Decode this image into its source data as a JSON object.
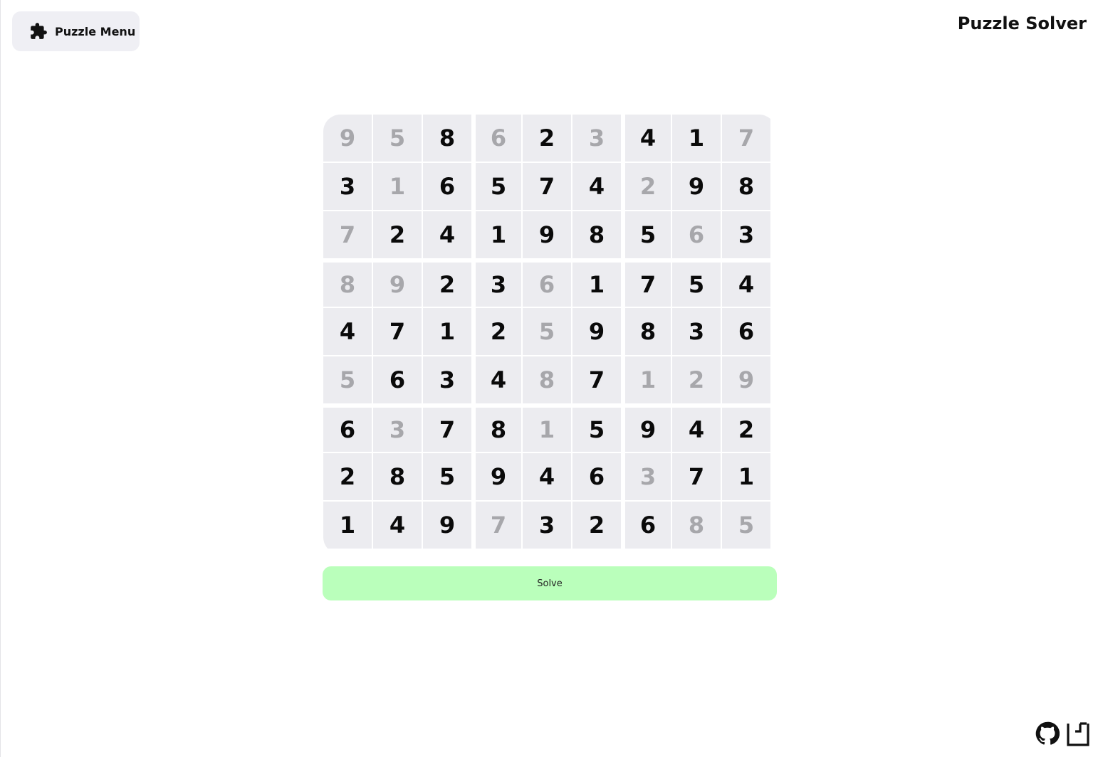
{
  "header": {
    "menu_label": "Puzzle Menu",
    "menu_icon": "puzzle-piece-icon",
    "title": "Puzzle Solver"
  },
  "board": {
    "rows": [
      [
        "9",
        "5",
        "8",
        "6",
        "2",
        "3",
        "4",
        "1",
        "7"
      ],
      [
        "3",
        "1",
        "6",
        "5",
        "7",
        "4",
        "2",
        "9",
        "8"
      ],
      [
        "7",
        "2",
        "4",
        "1",
        "9",
        "8",
        "5",
        "6",
        "3"
      ],
      [
        "8",
        "9",
        "2",
        "3",
        "6",
        "1",
        "7",
        "5",
        "4"
      ],
      [
        "4",
        "7",
        "1",
        "2",
        "5",
        "9",
        "8",
        "3",
        "6"
      ],
      [
        "5",
        "6",
        "3",
        "4",
        "8",
        "7",
        "1",
        "2",
        "9"
      ],
      [
        "6",
        "3",
        "7",
        "8",
        "1",
        "5",
        "9",
        "4",
        "2"
      ],
      [
        "2",
        "8",
        "5",
        "9",
        "4",
        "6",
        "3",
        "7",
        "1"
      ],
      [
        "1",
        "4",
        "9",
        "7",
        "3",
        "2",
        "6",
        "8",
        "5"
      ]
    ],
    "light": [
      [
        1,
        1,
        0,
        1,
        0,
        1,
        0,
        0,
        1
      ],
      [
        0,
        1,
        0,
        0,
        0,
        0,
        1,
        0,
        0
      ],
      [
        1,
        0,
        0,
        0,
        0,
        0,
        0,
        1,
        0
      ],
      [
        1,
        1,
        0,
        0,
        1,
        0,
        0,
        0,
        0
      ],
      [
        0,
        0,
        0,
        0,
        1,
        0,
        0,
        0,
        0
      ],
      [
        1,
        0,
        0,
        0,
        1,
        0,
        1,
        1,
        1
      ],
      [
        0,
        1,
        0,
        0,
        1,
        0,
        0,
        0,
        0
      ],
      [
        0,
        0,
        0,
        0,
        0,
        0,
        1,
        0,
        0
      ],
      [
        0,
        0,
        0,
        1,
        0,
        0,
        0,
        1,
        1
      ]
    ]
  },
  "actions": {
    "solve_label": "Solve"
  },
  "footer": {
    "icons": [
      "github-icon",
      "site-logo-icon"
    ]
  },
  "colors": {
    "cell_background": "#ececf0",
    "light_digit": "#a7a7ab",
    "dark_digit": "#0a0a0a",
    "solve_button": "#baffbb",
    "menu_button": "#efeff4"
  }
}
